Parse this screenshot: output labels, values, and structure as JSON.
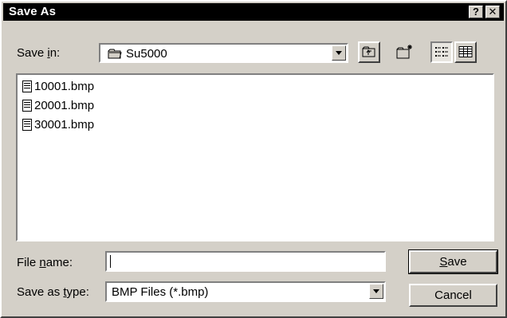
{
  "window": {
    "title": "Save As",
    "help_label": "?",
    "close_label": "✕"
  },
  "save_in": {
    "label_pre": "Save ",
    "label_hot": "i",
    "label_post": "n:",
    "value": "Su5000"
  },
  "toolbar": {
    "icons": [
      "up-folder-icon",
      "new-folder-icon",
      "list-view-icon",
      "details-view-icon"
    ]
  },
  "files": [
    {
      "name": "10001.bmp"
    },
    {
      "name": "20001.bmp"
    },
    {
      "name": "30001.bmp"
    }
  ],
  "file_name": {
    "label_pre": "File ",
    "label_hot": "n",
    "label_post": "ame:",
    "value": ""
  },
  "save_type": {
    "label_pre": "Save as ",
    "label_hot": "t",
    "label_post": "ype:",
    "value": "BMP Files (*.bmp)"
  },
  "buttons": {
    "save_hot": "S",
    "save_rest": "ave",
    "cancel": "Cancel"
  }
}
